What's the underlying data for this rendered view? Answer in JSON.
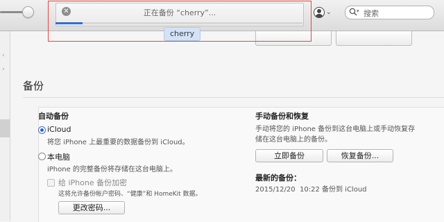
{
  "toolbar": {
    "status_text": "正在备份 “cherry”...",
    "progress_percent": 11,
    "device_name": "cherry",
    "close_glyph": "✕",
    "account_chevron": "⌄",
    "search_placeholder": "搜索",
    "search_chevron": "▾"
  },
  "sidebar": {
    "marks": [
      "‹",
      "›"
    ]
  },
  "backup": {
    "section_title": "备份",
    "auto": {
      "heading": "自动备份",
      "icloud_label": "iCloud",
      "icloud_desc": "将您 iPhone 上最重要的数据备份到 iCloud。",
      "local_label": "本电脑",
      "local_desc": "iPhone 的完整备份将存储在这台电脑上。",
      "encrypt_label": "给 iPhone 备份加密",
      "encrypt_desc": "这将允许备份帐户密码、“健康”和 HomeKit 数据。",
      "change_password": "更改密码..."
    },
    "manual": {
      "heading": "手动备份和恢复",
      "desc_line1": "手动将您的 iPhone 备份到这台电脑上或手动恢复存",
      "desc_line2": "储在这台电脑上的备份。",
      "backup_now": "立即备份",
      "restore": "恢复备份...",
      "latest_heading": "最新的备份：",
      "latest_value": "2015/12/20  10:22 备份到 iCloud"
    }
  },
  "colors": {
    "progress": "#2f6fd3",
    "highlight_border": "#e04545",
    "radio_selected": "#2f62c9"
  }
}
